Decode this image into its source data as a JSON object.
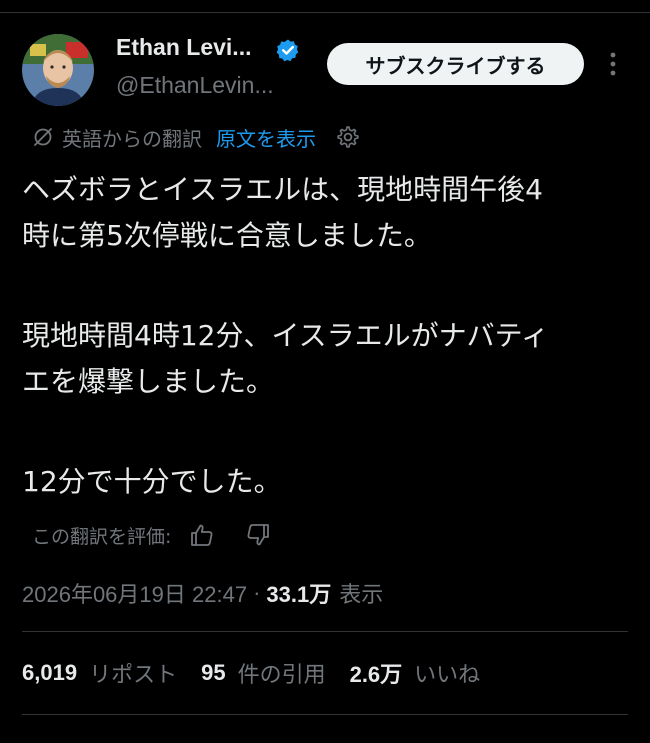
{
  "author": {
    "display_name": "Ethan Levi...",
    "handle": "@EthanLevin...",
    "verified_icon": "verified-badge-icon",
    "avatar_icon": "avatar"
  },
  "actions": {
    "subscribe_label": "サブスクライブする",
    "more_icon": "more-vertical-icon"
  },
  "translation": {
    "label": "英語からの翻訳",
    "show_original": "原文を表示",
    "translate_icon": "translate-icon",
    "settings_icon": "gear-icon"
  },
  "tweet": {
    "lines": [
      "ヘズボラとイスラエルは、現地時間午後4",
      "時に第5次停戦に合意しました。",
      "現地時間4時12分、イスラエルがナバティ",
      "エを爆撃しました。",
      "12分で十分でした。"
    ]
  },
  "rating": {
    "label": "この翻訳を評価:",
    "up_icon": "thumbs-up-icon",
    "down_icon": "thumbs-down-icon"
  },
  "meta": {
    "timestamp": "2026年06月19日 22:47",
    "separator": "·",
    "views_count": "33.1万",
    "views_label": "表示"
  },
  "stats": {
    "reposts_count": "6,019",
    "reposts_label": "リポスト",
    "quotes_count": "95",
    "quotes_label": "件の引用",
    "likes_count": "2.6万",
    "likes_label": "いいね"
  },
  "colors": {
    "background": "#000000",
    "text_primary": "#e7e9ea",
    "text_secondary": "#71767b",
    "accent": "#1d9bf0",
    "divider": "#2f3336"
  }
}
